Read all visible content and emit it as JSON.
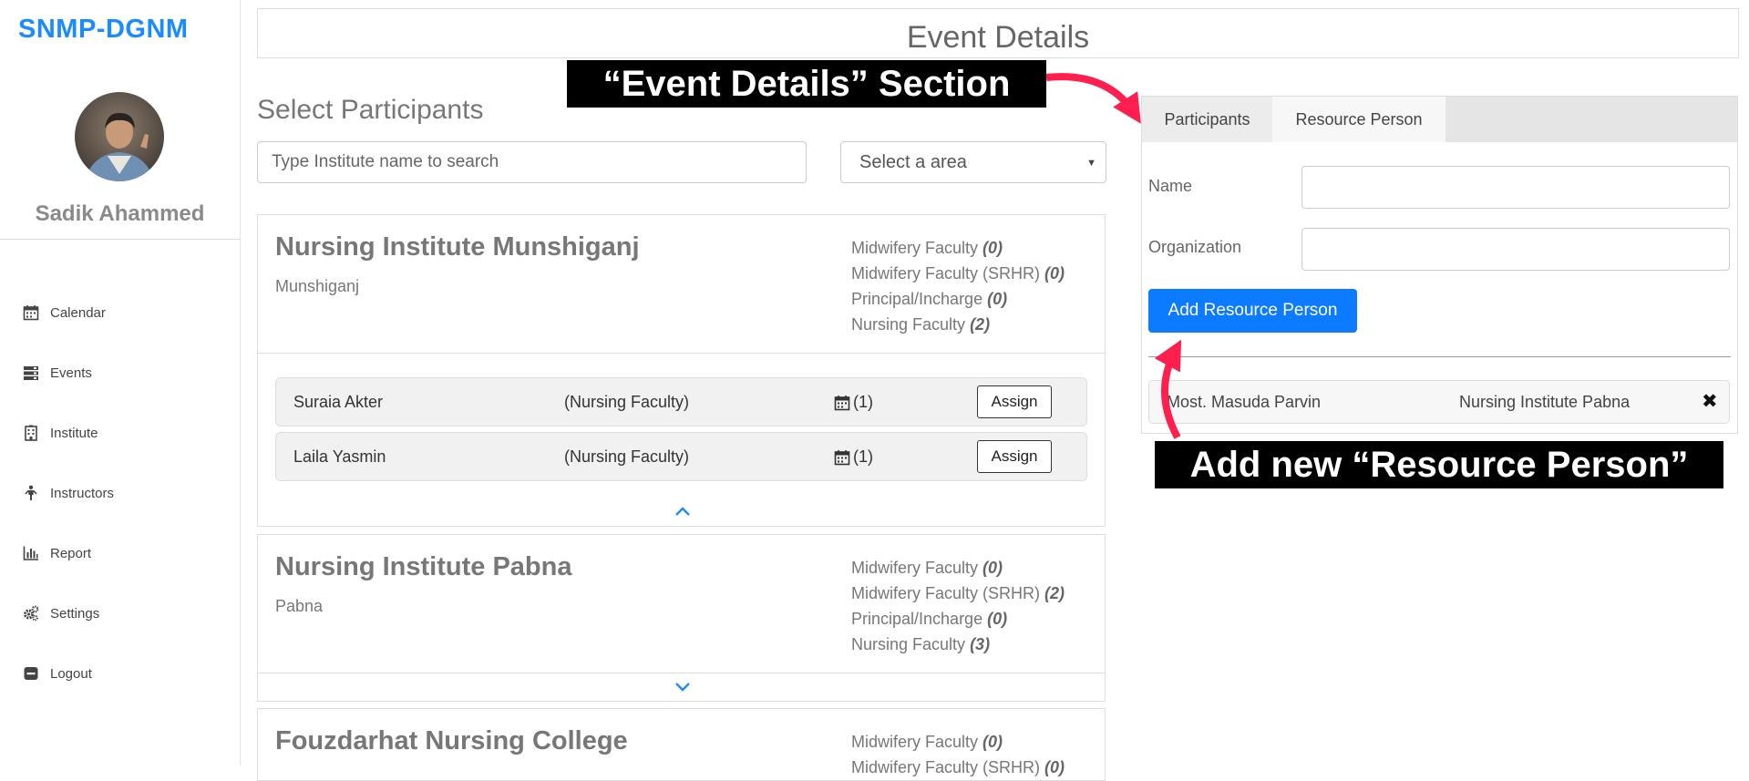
{
  "sidebar": {
    "brand": "SNMP-DGNM",
    "user_name": "Sadik Ahammed",
    "nav": [
      {
        "label": "Calendar",
        "icon": "calendar-icon"
      },
      {
        "label": "Events",
        "icon": "server-icon"
      },
      {
        "label": "Institute",
        "icon": "building-icon"
      },
      {
        "label": "Instructors",
        "icon": "person-icon"
      },
      {
        "label": "Report",
        "icon": "bar-chart-icon"
      },
      {
        "label": "Settings",
        "icon": "gears-icon"
      },
      {
        "label": "Logout",
        "icon": "minus-square-icon"
      }
    ]
  },
  "header": {
    "title": "Event Details"
  },
  "participants": {
    "title": "Select Participants",
    "search_placeholder": "Type Institute name to search",
    "area_select": "Select a area",
    "institutes": [
      {
        "name": "Nursing Institute Munshiganj",
        "location": "Munshiganj",
        "counts": [
          {
            "label": "Midwifery Faculty",
            "value": "(0)"
          },
          {
            "label": "Midwifery Faculty (SRHR)",
            "value": "(0)"
          },
          {
            "label": "Principal/Incharge",
            "value": "(0)"
          },
          {
            "label": "Nursing Faculty",
            "value": "(2)"
          }
        ],
        "staff": [
          {
            "name": "Suraia Akter",
            "role": "(Nursing Faculty)",
            "events": "(1)",
            "action": "Assign"
          },
          {
            "name": "Laila Yasmin",
            "role": "(Nursing Faculty)",
            "events": "(1)",
            "action": "Assign"
          }
        ]
      },
      {
        "name": "Nursing Institute Pabna",
        "location": "Pabna",
        "counts": [
          {
            "label": "Midwifery Faculty",
            "value": "(0)"
          },
          {
            "label": "Midwifery Faculty (SRHR)",
            "value": "(2)"
          },
          {
            "label": "Principal/Incharge",
            "value": "(0)"
          },
          {
            "label": "Nursing Faculty",
            "value": "(3)"
          }
        ]
      },
      {
        "name": "Fouzdarhat Nursing College",
        "counts": [
          {
            "label": "Midwifery Faculty",
            "value": "(0)"
          },
          {
            "label": "Midwifery Faculty (SRHR)",
            "value": "(0)"
          }
        ]
      }
    ]
  },
  "resource_panel": {
    "tabs": [
      "Participants",
      "Resource Person"
    ],
    "name_label": "Name",
    "org_label": "Organization",
    "add_button": "Add Resource Person",
    "persons": [
      {
        "name": "Most. Masuda Parvin",
        "org": "Nursing Institute Pabna",
        "remove": "✖"
      }
    ]
  },
  "callouts": {
    "event_details": "“Event Details” Section",
    "add_resource": "Add new “Resource Person”"
  },
  "colors": {
    "brand": "#1a8cff",
    "primary_button": "#0d7bff",
    "annotation_arrow": "#ff1f4e",
    "callout_bg": "#000000"
  }
}
